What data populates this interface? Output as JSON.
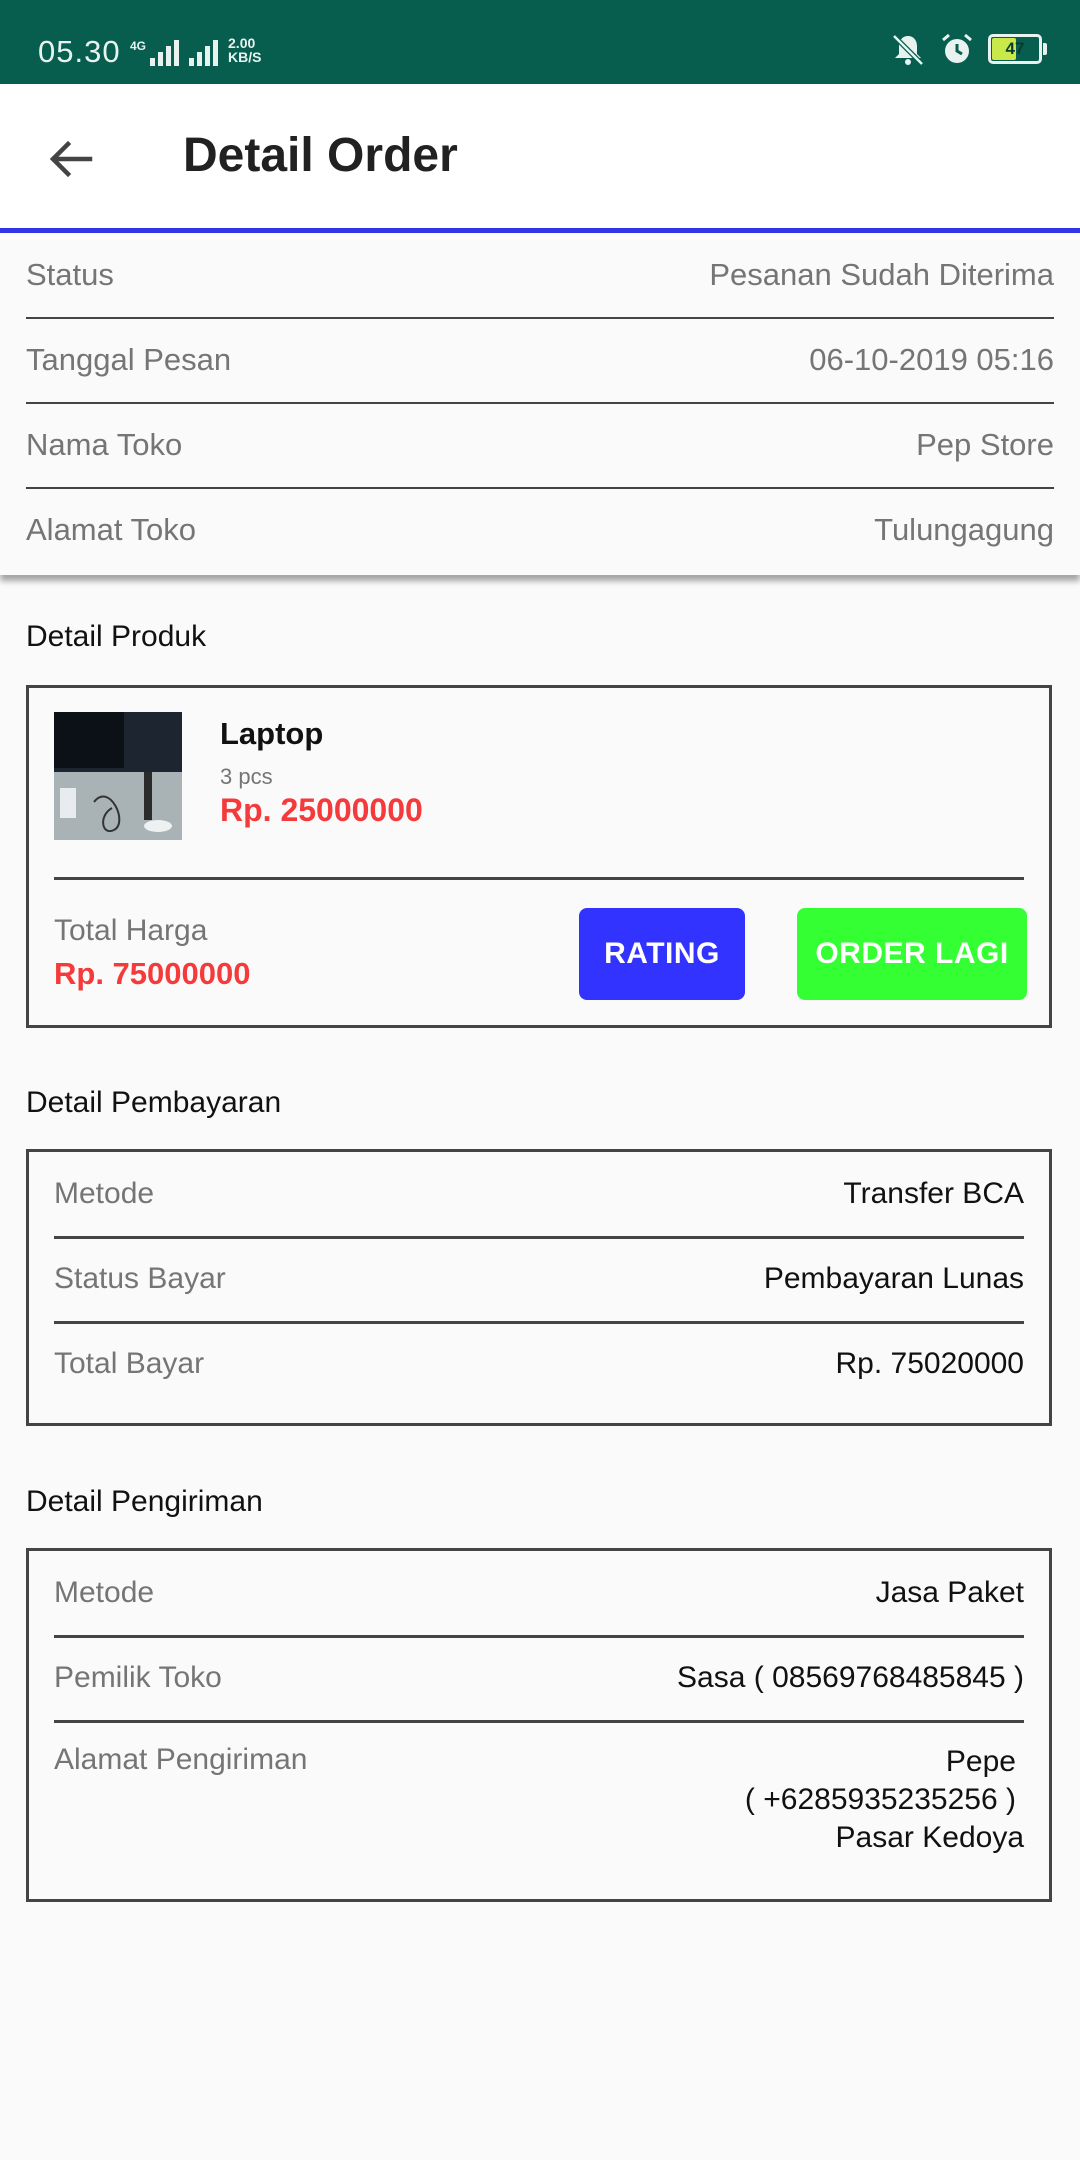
{
  "status_bar": {
    "time": "05.30",
    "network": "4G",
    "speed": "2.00\nKB/S",
    "battery": "47",
    "icons": [
      "mute-icon",
      "alarm-icon",
      "battery-icon"
    ]
  },
  "app_bar": {
    "title": "Detail Order",
    "back_icon": "arrow-left-icon"
  },
  "order_info": [
    {
      "label": "Status",
      "value": "Pesanan Sudah Diterima"
    },
    {
      "label": "Tanggal Pesan",
      "value": "06-10-2019 05:16"
    },
    {
      "label": "Nama Toko",
      "value": "Pep Store"
    },
    {
      "label": "Alamat Toko",
      "value": "Tulungagung"
    }
  ],
  "product_section": {
    "title": "Detail Produk",
    "product": {
      "name": "Laptop",
      "qty": "3 pcs",
      "price": "Rp. 25000000"
    },
    "total_label": "Total Harga",
    "total_value": "Rp. 75000000",
    "rating_button": "RATING",
    "order_again_button": "ORDER LAGI"
  },
  "payment_section": {
    "title": "Detail Pembayaran",
    "rows": [
      {
        "label": "Metode",
        "value": "Transfer BCA"
      },
      {
        "label": "Status Bayar",
        "value": "Pembayaran Lunas"
      },
      {
        "label": "Total Bayar",
        "value": "Rp. 75020000"
      }
    ]
  },
  "shipping_section": {
    "title": "Detail Pengiriman",
    "rows": [
      {
        "label": "Metode",
        "value": "Jasa Paket"
      },
      {
        "label": "Pemilik Toko",
        "value": "Sasa ( 08569768485845 )"
      }
    ],
    "address_label": "Alamat Pengiriman",
    "address_lines": [
      "Pepe",
      "( +6285935235256 )",
      "Pasar Kedoya"
    ]
  },
  "colors": {
    "status_bar": "#075e4f",
    "accent_line": "#3333e6",
    "price_red": "#f43a3a",
    "rating_button": "#3333ff",
    "order_button": "#33ff33"
  }
}
